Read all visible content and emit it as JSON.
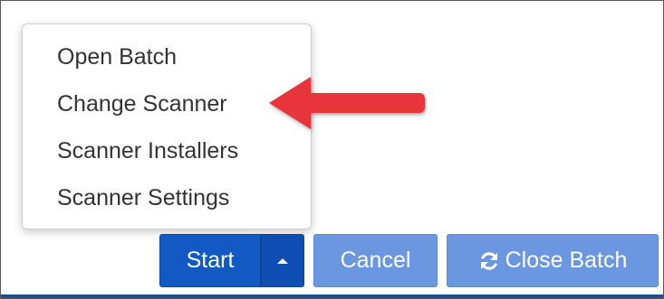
{
  "menu": {
    "items": [
      {
        "label": "Open Batch"
      },
      {
        "label": "Change Scanner"
      },
      {
        "label": "Scanner Installers"
      },
      {
        "label": "Scanner Settings"
      }
    ]
  },
  "buttons": {
    "start_label": "Start",
    "caret_icon": "caret-up-icon",
    "cancel_label": "Cancel",
    "close_batch_label": "Close Batch",
    "close_batch_icon": "refresh-icon"
  },
  "annotation": {
    "arrow_icon": "red-arrow-pointer",
    "arrow_color": "#e8353b"
  },
  "colors": {
    "primary": "#1259c3",
    "secondary": "#6b96e0",
    "text": "#333333"
  }
}
